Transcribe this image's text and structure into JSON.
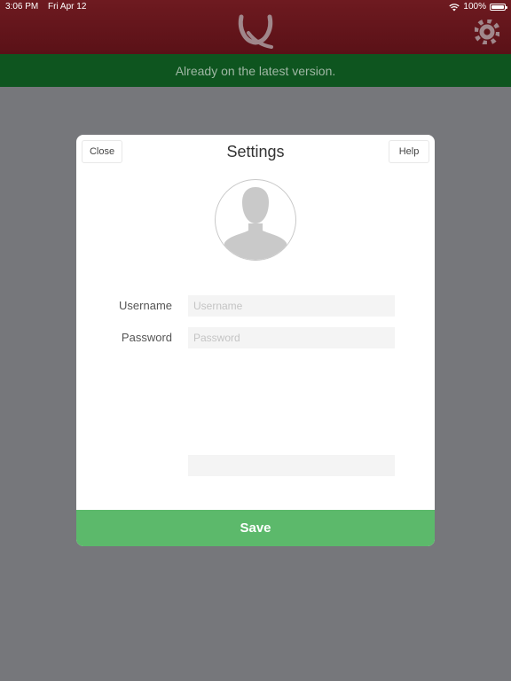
{
  "status_bar": {
    "time": "3:06 PM",
    "date": "Fri Apr 12",
    "battery": "100%",
    "battery_level": 1.0
  },
  "header": {
    "logo_icon": "stylized-q-logo-icon",
    "settings_icon": "gear-icon"
  },
  "banner": {
    "message": "Already on the latest version."
  },
  "modal": {
    "title": "Settings",
    "close_label": "Close",
    "help_label": "Help",
    "avatar_icon": "person-silhouette-icon",
    "username_label": "Username",
    "username_placeholder": "Username",
    "username_value": "",
    "password_label": "Password",
    "password_placeholder": "Password",
    "password_value": "",
    "extra_field_value": "",
    "save_label": "Save"
  },
  "colors": {
    "header": "#6e1a20",
    "banner": "#0e551f",
    "banner_text": "#9fb7a4",
    "overlay": "#76777b",
    "save_button": "#5cb96b"
  }
}
